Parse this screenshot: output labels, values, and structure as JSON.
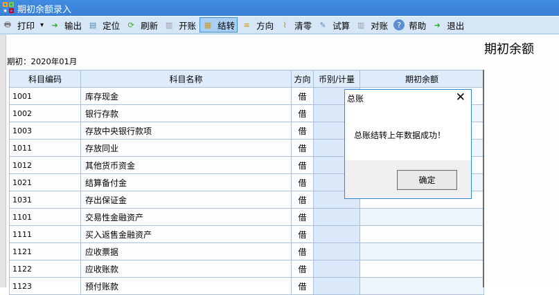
{
  "window": {
    "title": "期初余额录入"
  },
  "toolbar": [
    {
      "label": "打印",
      "icon": "printer-icon",
      "dropdown": true
    },
    {
      "label": "输出",
      "icon": "export-icon"
    },
    {
      "label": "定位",
      "icon": "locate-icon"
    },
    {
      "label": "刷新",
      "icon": "refresh-icon"
    },
    {
      "label": "开账",
      "icon": "open-ledger-icon"
    },
    {
      "label": "结转",
      "icon": "carry-forward-icon",
      "active": true
    },
    {
      "label": "方向",
      "icon": "direction-icon"
    },
    {
      "label": "清零",
      "icon": "broom-icon"
    },
    {
      "label": "试算",
      "icon": "trial-balance-icon"
    },
    {
      "label": "对账",
      "icon": "reconcile-icon"
    },
    {
      "label": "帮助",
      "icon": "help-icon"
    },
    {
      "label": "退出",
      "icon": "exit-icon"
    }
  ],
  "page": {
    "heading": "期初余额",
    "period": "期初：2020年01月"
  },
  "table": {
    "headers": [
      "科目编码",
      "科目名称",
      "方向",
      "币别/计量",
      "期初余额"
    ],
    "rows": [
      [
        "1001",
        "库存现金",
        "借",
        "",
        ""
      ],
      [
        "1002",
        "银行存款",
        "借",
        "",
        ""
      ],
      [
        "1003",
        "存放中央银行款项",
        "借",
        "",
        ""
      ],
      [
        "1011",
        "存放同业",
        "借",
        "",
        ""
      ],
      [
        "1012",
        "其他货币资金",
        "借",
        "",
        ""
      ],
      [
        "1021",
        "结算备付金",
        "借",
        "",
        ""
      ],
      [
        "1031",
        "存出保证金",
        "借",
        "",
        ""
      ],
      [
        "1101",
        "交易性金融资产",
        "借",
        "",
        ""
      ],
      [
        "1111",
        "买入返售金融资产",
        "借",
        "",
        ""
      ],
      [
        "1121",
        "应收票据",
        "借",
        "",
        ""
      ],
      [
        "1122",
        "应收账款",
        "借",
        "",
        ""
      ],
      [
        "1123",
        "预付账款",
        "借",
        "",
        ""
      ]
    ]
  },
  "dialog": {
    "title": "总账",
    "message": "总账结转上年数据成功！",
    "ok_label": "确定"
  },
  "colors": {
    "titlebar": "#3a7fd6",
    "toolbar": "#d6e6f7",
    "header": "#deebfb",
    "dialog_border": "#2f86d8"
  }
}
